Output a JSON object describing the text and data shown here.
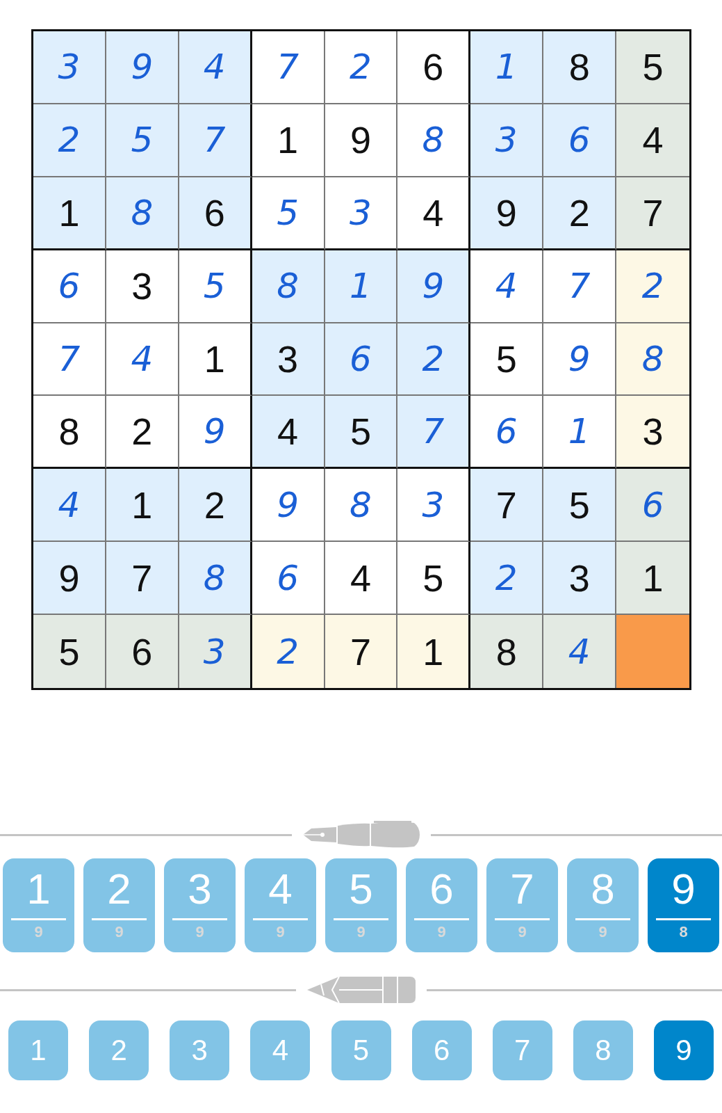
{
  "board": {
    "rows": [
      [
        {
          "value": "3",
          "entered": true,
          "selected": false
        },
        {
          "value": "9",
          "entered": true,
          "selected": false
        },
        {
          "value": "4",
          "entered": true,
          "selected": false
        },
        {
          "value": "7",
          "entered": true,
          "selected": false
        },
        {
          "value": "2",
          "entered": true,
          "selected": false
        },
        {
          "value": "6",
          "entered": false,
          "selected": false
        },
        {
          "value": "1",
          "entered": true,
          "selected": false
        },
        {
          "value": "8",
          "entered": false,
          "selected": false
        },
        {
          "value": "5",
          "entered": false,
          "selected": false
        }
      ],
      [
        {
          "value": "2",
          "entered": true,
          "selected": false
        },
        {
          "value": "5",
          "entered": true,
          "selected": false
        },
        {
          "value": "7",
          "entered": true,
          "selected": false
        },
        {
          "value": "1",
          "entered": false,
          "selected": false
        },
        {
          "value": "9",
          "entered": false,
          "selected": false
        },
        {
          "value": "8",
          "entered": true,
          "selected": false
        },
        {
          "value": "3",
          "entered": true,
          "selected": false
        },
        {
          "value": "6",
          "entered": true,
          "selected": false
        },
        {
          "value": "4",
          "entered": false,
          "selected": false
        }
      ],
      [
        {
          "value": "1",
          "entered": false,
          "selected": false
        },
        {
          "value": "8",
          "entered": true,
          "selected": false
        },
        {
          "value": "6",
          "entered": false,
          "selected": false
        },
        {
          "value": "5",
          "entered": true,
          "selected": false
        },
        {
          "value": "3",
          "entered": true,
          "selected": false
        },
        {
          "value": "4",
          "entered": false,
          "selected": false
        },
        {
          "value": "9",
          "entered": false,
          "selected": false
        },
        {
          "value": "2",
          "entered": false,
          "selected": false
        },
        {
          "value": "7",
          "entered": false,
          "selected": false
        }
      ],
      [
        {
          "value": "6",
          "entered": true,
          "selected": false
        },
        {
          "value": "3",
          "entered": false,
          "selected": false
        },
        {
          "value": "5",
          "entered": true,
          "selected": false
        },
        {
          "value": "8",
          "entered": true,
          "selected": false
        },
        {
          "value": "1",
          "entered": true,
          "selected": false
        },
        {
          "value": "9",
          "entered": true,
          "selected": false
        },
        {
          "value": "4",
          "entered": true,
          "selected": false
        },
        {
          "value": "7",
          "entered": true,
          "selected": false
        },
        {
          "value": "2",
          "entered": true,
          "selected": false
        }
      ],
      [
        {
          "value": "7",
          "entered": true,
          "selected": false
        },
        {
          "value": "4",
          "entered": true,
          "selected": false
        },
        {
          "value": "1",
          "entered": false,
          "selected": false
        },
        {
          "value": "3",
          "entered": false,
          "selected": false
        },
        {
          "value": "6",
          "entered": true,
          "selected": false
        },
        {
          "value": "2",
          "entered": true,
          "selected": false
        },
        {
          "value": "5",
          "entered": false,
          "selected": false
        },
        {
          "value": "9",
          "entered": true,
          "selected": false
        },
        {
          "value": "8",
          "entered": true,
          "selected": false
        }
      ],
      [
        {
          "value": "8",
          "entered": false,
          "selected": false
        },
        {
          "value": "2",
          "entered": false,
          "selected": false
        },
        {
          "value": "9",
          "entered": true,
          "selected": false
        },
        {
          "value": "4",
          "entered": false,
          "selected": false
        },
        {
          "value": "5",
          "entered": false,
          "selected": false
        },
        {
          "value": "7",
          "entered": true,
          "selected": false
        },
        {
          "value": "6",
          "entered": true,
          "selected": false
        },
        {
          "value": "1",
          "entered": true,
          "selected": false
        },
        {
          "value": "3",
          "entered": false,
          "selected": false
        }
      ],
      [
        {
          "value": "4",
          "entered": true,
          "selected": false
        },
        {
          "value": "1",
          "entered": false,
          "selected": false
        },
        {
          "value": "2",
          "entered": false,
          "selected": false
        },
        {
          "value": "9",
          "entered": true,
          "selected": false
        },
        {
          "value": "8",
          "entered": true,
          "selected": false
        },
        {
          "value": "3",
          "entered": true,
          "selected": false
        },
        {
          "value": "7",
          "entered": false,
          "selected": false
        },
        {
          "value": "5",
          "entered": false,
          "selected": false
        },
        {
          "value": "6",
          "entered": true,
          "selected": false
        }
      ],
      [
        {
          "value": "9",
          "entered": false,
          "selected": false
        },
        {
          "value": "7",
          "entered": false,
          "selected": false
        },
        {
          "value": "8",
          "entered": true,
          "selected": false
        },
        {
          "value": "6",
          "entered": true,
          "selected": false
        },
        {
          "value": "4",
          "entered": false,
          "selected": false
        },
        {
          "value": "5",
          "entered": false,
          "selected": false
        },
        {
          "value": "2",
          "entered": true,
          "selected": false
        },
        {
          "value": "3",
          "entered": false,
          "selected": false
        },
        {
          "value": "1",
          "entered": false,
          "selected": false
        }
      ],
      [
        {
          "value": "5",
          "entered": false,
          "selected": false
        },
        {
          "value": "6",
          "entered": false,
          "selected": false
        },
        {
          "value": "3",
          "entered": true,
          "selected": false
        },
        {
          "value": "2",
          "entered": true,
          "selected": false
        },
        {
          "value": "7",
          "entered": false,
          "selected": false
        },
        {
          "value": "1",
          "entered": false,
          "selected": false
        },
        {
          "value": "8",
          "entered": false,
          "selected": false
        },
        {
          "value": "4",
          "entered": true,
          "selected": false
        },
        {
          "selected": true
        }
      ]
    ]
  },
  "pen_keys": [
    {
      "digit": "1",
      "count": "9",
      "selected": false
    },
    {
      "digit": "2",
      "count": "9",
      "selected": false
    },
    {
      "digit": "3",
      "count": "9",
      "selected": false
    },
    {
      "digit": "4",
      "count": "9",
      "selected": false
    },
    {
      "digit": "5",
      "count": "9",
      "selected": false
    },
    {
      "digit": "6",
      "count": "9",
      "selected": false
    },
    {
      "digit": "7",
      "count": "9",
      "selected": false
    },
    {
      "digit": "8",
      "count": "9",
      "selected": false
    },
    {
      "digit": "9",
      "count": "8",
      "selected": true
    }
  ],
  "pencil_keys": [
    {
      "digit": "1",
      "selected": false
    },
    {
      "digit": "2",
      "selected": false
    },
    {
      "digit": "3",
      "selected": false
    },
    {
      "digit": "4",
      "selected": false
    },
    {
      "digit": "5",
      "selected": false
    },
    {
      "digit": "6",
      "selected": false
    },
    {
      "digit": "7",
      "selected": false
    },
    {
      "digit": "8",
      "selected": false
    },
    {
      "digit": "9",
      "selected": true
    }
  ]
}
